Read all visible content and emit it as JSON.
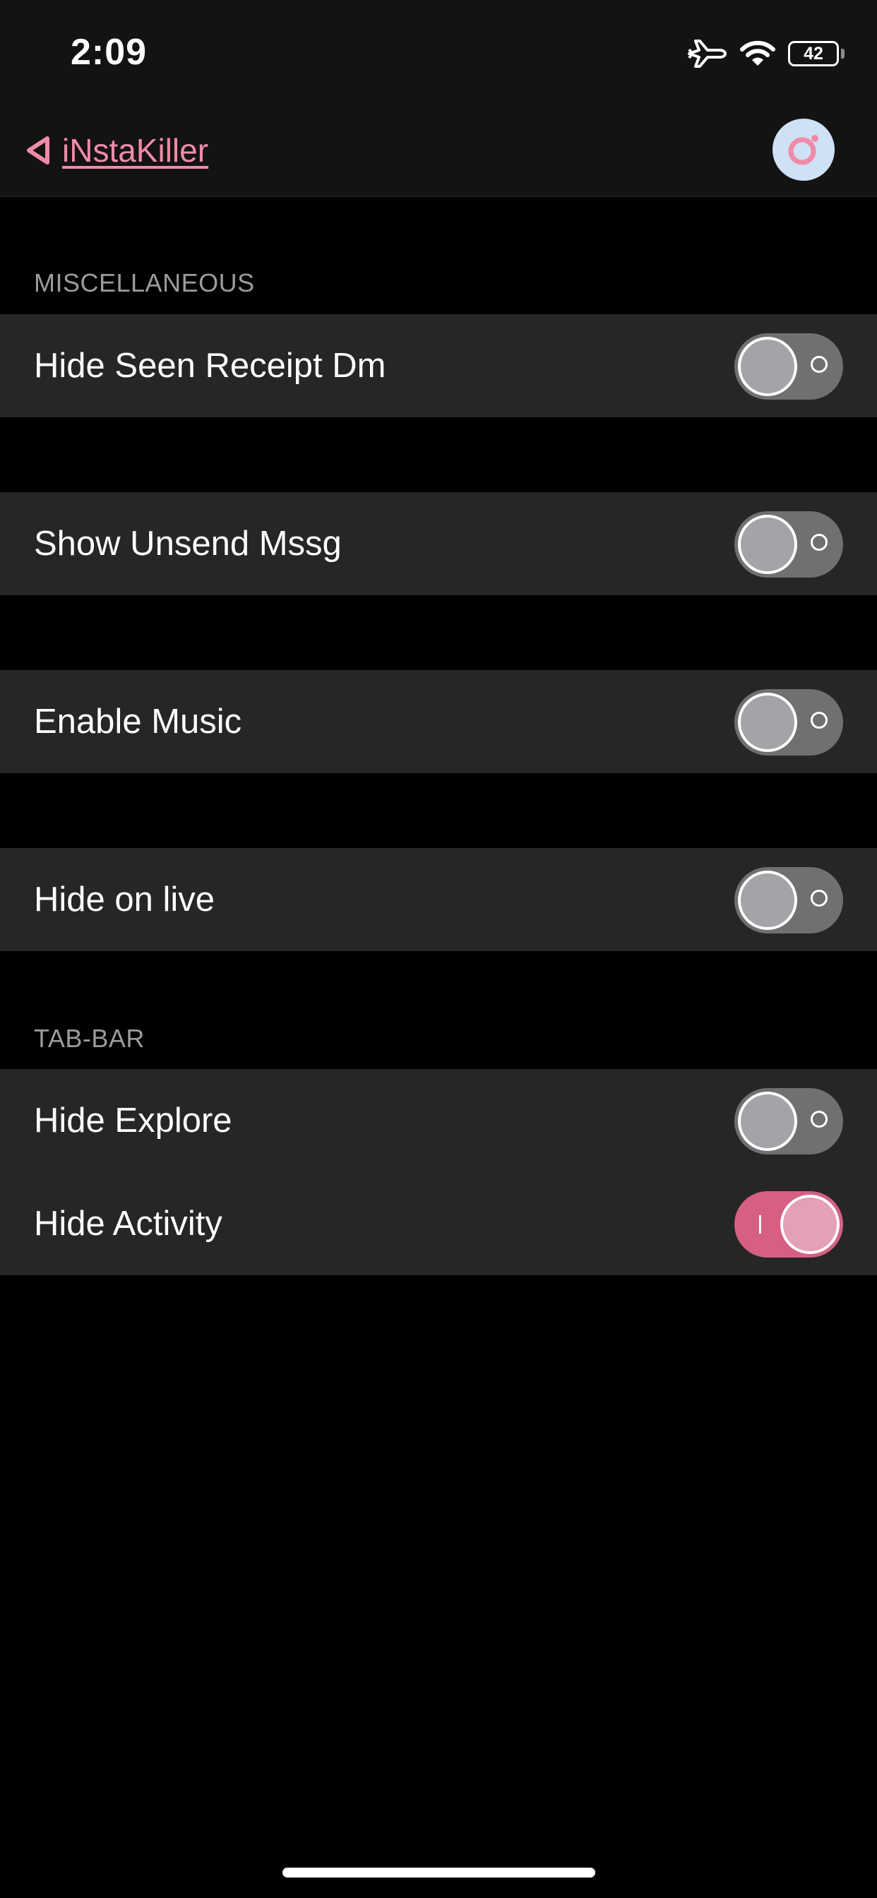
{
  "status_bar": {
    "time": "2:09",
    "battery": "42"
  },
  "nav": {
    "back_label": "iNstaKiller"
  },
  "sections": {
    "misc": {
      "header": "MISCELLANEOUS"
    },
    "tabbar": {
      "header": "TAB-BAR"
    }
  },
  "rows": {
    "hide_seen": {
      "label": "Hide Seen Receipt Dm",
      "on": false
    },
    "show_unsend": {
      "label": "Show Unsend Mssg",
      "on": false
    },
    "enable_music": {
      "label": "Enable Music",
      "on": false
    },
    "hide_live": {
      "label": "Hide on live",
      "on": false
    },
    "hide_explore": {
      "label": "Hide Explore",
      "on": false
    },
    "hide_activity": {
      "label": "Hide Activity",
      "on": true
    }
  },
  "colors": {
    "accent": "#f08aa8",
    "toggle_on": "#d65f82",
    "toggle_off": "#707072",
    "cell_background": "#262626",
    "avatar_background": "#cfe1f5"
  },
  "icons": {
    "back": "triangle-back-icon",
    "avatar": "instagram-ring-icon",
    "airplane": "airplane-icon",
    "wifi": "wifi-icon",
    "battery": "battery-icon"
  }
}
